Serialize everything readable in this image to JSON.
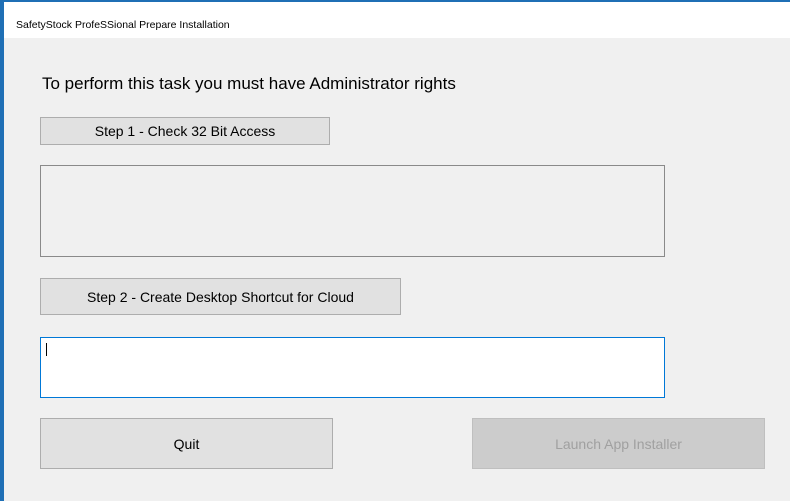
{
  "window": {
    "title": "SafetyStock ProfeSSional Prepare Installation"
  },
  "main": {
    "heading": "To perform this task you must have Administrator rights",
    "step1_label": "Step 1 - Check 32 Bit Access",
    "step1_output": "",
    "step2_label": "Step 2 - Create Desktop Shortcut for Cloud",
    "step2_output": "",
    "quit_label": "Quit",
    "launch_label": "Launch App Installer"
  },
  "colors": {
    "window_border": "#1f6fb5",
    "focus_border": "#0078d7",
    "button_face": "#e1e1e1",
    "disabled_text": "#a0a0a0"
  }
}
